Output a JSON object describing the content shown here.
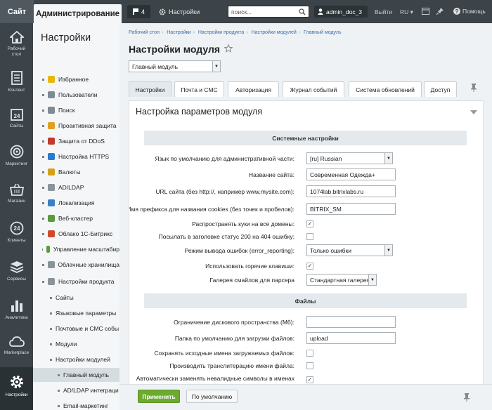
{
  "topbar": {
    "site_tab": "Сайт",
    "admin_tab": "Администрирование",
    "notifications_count": "4",
    "settings_label": "Настройки",
    "search_placeholder": "поиск...",
    "user_name": "admin_doc_3",
    "exit_label": "Выйти",
    "language": "RU",
    "help_label": "Помощь"
  },
  "leftbar": {
    "items": [
      {
        "label": "Рабочий\nстол",
        "icon": "home-icon"
      },
      {
        "label": "Контент",
        "icon": "document-icon"
      },
      {
        "label": "Сайты",
        "icon": "calendar-icon"
      },
      {
        "label": "Маркетинг",
        "icon": "target-icon"
      },
      {
        "label": "Магазин",
        "icon": "basket-icon"
      },
      {
        "label": "Клиенты",
        "icon": "clients-icon"
      },
      {
        "label": "Сервисы",
        "icon": "layers-icon"
      },
      {
        "label": "Аналитика",
        "icon": "bar-chart-icon"
      },
      {
        "label": "Marketplace",
        "icon": "cloud-icon"
      },
      {
        "label": "Настройки",
        "icon": "gear-icon"
      }
    ]
  },
  "sidebar": {
    "title": "Настройки",
    "items": [
      {
        "label": "Избранное",
        "icon_color": "#e8b800"
      },
      {
        "label": "Пользователи",
        "icon_color": "#7d8b94"
      },
      {
        "label": "Поиск",
        "icon_color": "#7d8b94"
      },
      {
        "label": "Проактивная защита",
        "icon_color": "#e0a020"
      },
      {
        "label": "Защита от DDoS",
        "icon_color": "#c0392b"
      },
      {
        "label": "Настройка HTTPS",
        "icon_color": "#2a7ad0"
      },
      {
        "label": "Валюты",
        "icon_color": "#d4a017"
      },
      {
        "label": "AD/LDAP",
        "icon_color": "#8a949a"
      },
      {
        "label": "Локализация",
        "icon_color": "#3a80c8"
      },
      {
        "label": "Веб-кластер",
        "icon_color": "#5a9c3a"
      },
      {
        "label": "Облако 1С-Битрикс",
        "icon_color": "#d04a2a"
      },
      {
        "label": "Управление масштабир",
        "icon_color": "#5a9c3a"
      },
      {
        "label": "Облачные хранилища",
        "icon_color": "#8a949a"
      },
      {
        "label": "Настройки продукта",
        "icon_color": "#8a949a"
      },
      {
        "label": "Сайты",
        "icon_color": ""
      },
      {
        "label": "Языковые параметры",
        "icon_color": ""
      },
      {
        "label": "Почтовые и СМС собы",
        "icon_color": ""
      },
      {
        "label": "Модули",
        "icon_color": ""
      },
      {
        "label": "Настройки модулей",
        "icon_color": ""
      },
      {
        "label": "Главный модуль",
        "icon_color": ""
      },
      {
        "label": "AD/LDAP интеграци",
        "icon_color": ""
      },
      {
        "label": "Email-маркетинг",
        "icon_color": ""
      },
      {
        "label": "Push and Pull",
        "icon_color": ""
      }
    ]
  },
  "breadcrumb": [
    "Рабочий стол",
    "Настройки",
    "Настройки продукта",
    "Настройки модулей",
    "Главный модуль"
  ],
  "page_title": "Настройки модуля",
  "module_select": "Главный модуль",
  "tabs": [
    "Настройки",
    "Почта и СМС",
    "Авторизация",
    "Журнал событий",
    "Система обновлений",
    "Доступ"
  ],
  "panel": {
    "title": "Настройка параметров модуля",
    "system_header": "Системные настройки",
    "files_header": "Файлы",
    "fields": {
      "default_lang_label": "Язык по умолчанию для административной части:",
      "default_lang_value": "[ru] Russian",
      "site_name_label": "Название сайта:",
      "site_name_value": "Современная Одежда+",
      "site_url_label": "URL сайта (без http://, например www.mysite.com):",
      "site_url_value": "1074lab.bitrixlabs.ru",
      "cookie_prefix_label": "Имя префикса для названия cookies (без точек и пробелов):",
      "cookie_prefix_value": "BITRIX_SM",
      "spread_cookies_label": "Распространять куки на все домены:",
      "send_200_label": "Посылать в заголовке статус 200 на 404 ошибку:",
      "error_mode_label": "Режим вывода ошибок (error_reporting):",
      "error_mode_value": "Только ошибки",
      "hotkeys_label": "Использовать горячие клавиши:",
      "smiles_label": "Галерея смайлов для парсера",
      "smiles_value": "Стандартная галерея",
      "disk_limit_label": "Ограничение дискового пространства (Мб):",
      "disk_limit_value": "",
      "upload_dir_label": "Папка по умолчанию для загрузки файлов:",
      "upload_dir_value": "upload",
      "keep_names_label": "Сохранять исходные имена загружаемых файлов:",
      "translit_label": "Производить транслитерацию имени файла:",
      "auto_replace_label": "Автоматически заменять невалидные символы в именах"
    }
  },
  "buttons": {
    "apply": "Применить",
    "default": "По умолчанию"
  }
}
